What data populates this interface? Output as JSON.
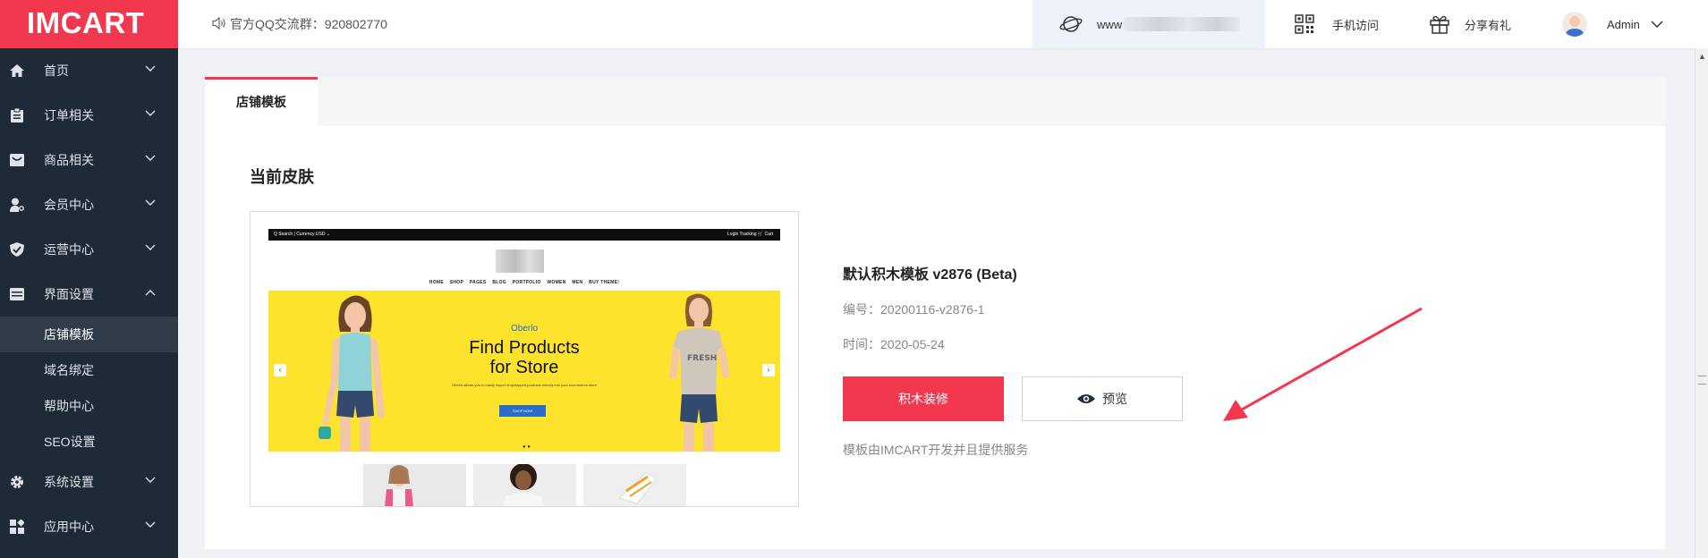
{
  "logo": "IMCART",
  "sidebar": {
    "items": [
      {
        "label": "首页",
        "icon": "home-icon"
      },
      {
        "label": "订单相关",
        "icon": "clipboard-icon"
      },
      {
        "label": "商品相关",
        "icon": "box-icon"
      },
      {
        "label": "会员中心",
        "icon": "user-key-icon"
      },
      {
        "label": "运营中心",
        "icon": "shield-icon"
      },
      {
        "label": "界面设置",
        "icon": "layout-icon",
        "expanded": true
      },
      {
        "label": "系统设置",
        "icon": "gear-icon"
      },
      {
        "label": "应用中心",
        "icon": "apps-icon"
      }
    ],
    "subitems": [
      "店铺模板",
      "域名绑定",
      "帮助中心",
      "SEO设置"
    ],
    "active_sub": "店铺模板"
  },
  "header": {
    "notice": "官方QQ交流群：920802770",
    "site_prefix": "www",
    "mobile_label": "手机访问",
    "share_label": "分享有礼",
    "user": "Admin"
  },
  "main": {
    "tab": "店铺模板",
    "section_title": "当前皮肤",
    "template": {
      "name": "默认积木模板 v2876 (Beta)",
      "code": "编号：20200116-v2876-1",
      "time": "时间：2020-05-24",
      "primary_button": "积木装修",
      "preview_button": "预览",
      "note": "模板由IMCART开发并且提供服务"
    },
    "preview": {
      "topbar_left": "Q Search   |   Currency USD ⌄",
      "topbar_right": "Login   Tracking   🛒 Cart",
      "menu": [
        "HOME",
        "SHOP",
        "PAGES",
        "BLOG",
        "PORTFOLIO",
        "WOMEN",
        "MEN",
        "BUY THEME!"
      ],
      "banner_sub": "Oberlo",
      "banner_title_1": "Find Products",
      "banner_title_2": "for Store",
      "banner_desc": "Oberlo allows you to easily import dropshipped products directly into your ecommerce store",
      "banner_button": "SHOP NOW"
    }
  },
  "colors": {
    "accent": "#f2384f",
    "sidebar_bg": "#1e2a35",
    "banner_yellow": "#fde32c"
  }
}
